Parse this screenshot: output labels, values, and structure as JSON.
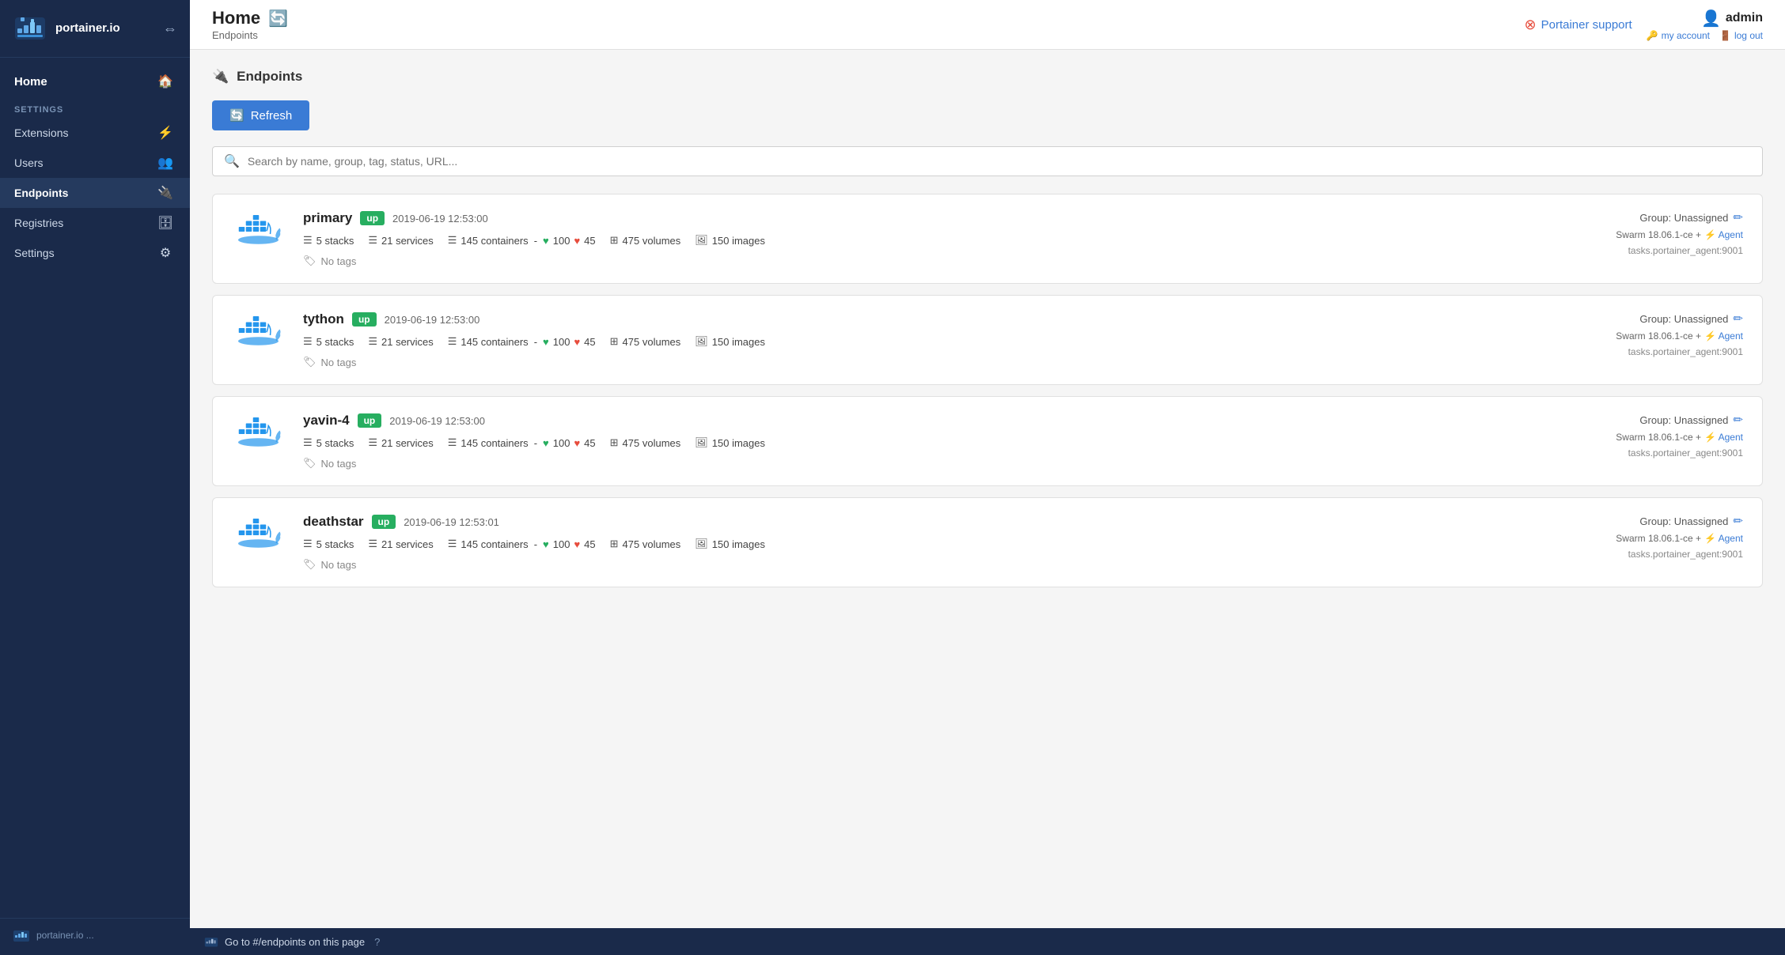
{
  "sidebar": {
    "logo_text": "portainer.io",
    "home_label": "Home",
    "settings_label": "SETTINGS",
    "nav_items": [
      {
        "id": "extensions",
        "label": "Extensions",
        "icon": "⚡"
      },
      {
        "id": "users",
        "label": "Users",
        "icon": "👥"
      },
      {
        "id": "endpoints",
        "label": "Endpoints",
        "icon": "🔌",
        "active": true
      },
      {
        "id": "registries",
        "label": "Registries",
        "icon": "🗄"
      },
      {
        "id": "settings",
        "label": "Settings",
        "icon": "⚙"
      }
    ]
  },
  "topbar": {
    "title": "Home",
    "subtitle": "Endpoints",
    "support_label": "Portainer support",
    "admin_label": "admin",
    "my_account_label": "my account",
    "log_out_label": "log out"
  },
  "page": {
    "section_title": "Endpoints",
    "refresh_label": "Refresh",
    "search_placeholder": "Search by name, group, tag, status, URL..."
  },
  "endpoints": [
    {
      "id": "primary",
      "name": "primary",
      "status": "up",
      "time": "2019-06-19 12:53:00",
      "stacks": 5,
      "services": 21,
      "containers": 145,
      "health_good": 100,
      "health_bad": 45,
      "volumes": 475,
      "images": 150,
      "tags": "No tags",
      "group": "Unassigned",
      "swarm_version": "Swarm 18.06.1-ce",
      "agent_label": "Agent",
      "url": "tasks.portainer_agent:9001"
    },
    {
      "id": "tython",
      "name": "tython",
      "status": "up",
      "time": "2019-06-19 12:53:00",
      "stacks": 5,
      "services": 21,
      "containers": 145,
      "health_good": 100,
      "health_bad": 45,
      "volumes": 475,
      "images": 150,
      "tags": "No tags",
      "group": "Unassigned",
      "swarm_version": "Swarm 18.06.1-ce",
      "agent_label": "Agent",
      "url": "tasks.portainer_agent:9001"
    },
    {
      "id": "yavin-4",
      "name": "yavin-4",
      "status": "up",
      "time": "2019-06-19 12:53:00",
      "stacks": 5,
      "services": 21,
      "containers": 145,
      "health_good": 100,
      "health_bad": 45,
      "volumes": 475,
      "images": 150,
      "tags": "No tags",
      "group": "Unassigned",
      "swarm_version": "Swarm 18.06.1-ce",
      "agent_label": "Agent",
      "url": "tasks.portainer_agent:9001"
    },
    {
      "id": "deathstar",
      "name": "deathstar",
      "status": "up",
      "time": "2019-06-19 12:53:01",
      "stacks": 5,
      "services": 21,
      "containers": 145,
      "health_good": 100,
      "health_bad": 45,
      "volumes": 475,
      "images": 150,
      "tags": "No tags",
      "group": "Unassigned",
      "swarm_version": "Swarm 18.06.1-ce",
      "agent_label": "Agent",
      "url": "tasks.portainer_agent:9001"
    }
  ],
  "footer": {
    "tooltip_text": "Go to #/endpoints on this page",
    "version_label": "portainer.io ..."
  },
  "colors": {
    "sidebar_bg": "#1a2a4a",
    "accent": "#3a7bd5",
    "status_up": "#27ae60"
  }
}
